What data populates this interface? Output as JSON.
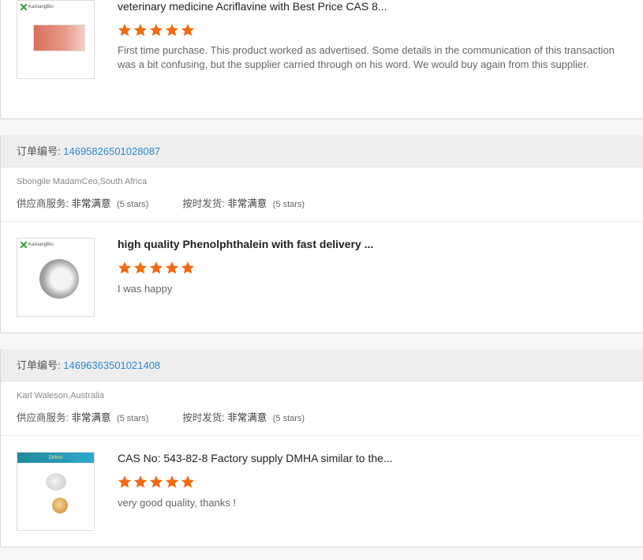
{
  "colors": {
    "accent": "#2b89c6",
    "star": "#f26a10"
  },
  "labels": {
    "order_no": "订单编号:",
    "supplier_service": "供应商服务:",
    "on_time": "按时发货:"
  },
  "card1": {
    "product_title": "veterinary medicine Acriflavine with Best Price CAS 8...",
    "rating": 5,
    "review": "First time purchase.  This product worked as advertised.  Some details in the communication of this transaction was a bit confusing, but the supplier carried through on his word.  We would buy again from this supplier.",
    "brand": "KaixiangBio"
  },
  "orders": [
    {
      "order_id": "14695826501028087",
      "buyer": "Sbongile MadamCeo,South Africa",
      "supplier_value": "非常满意",
      "supplier_stars": "(5 stars)",
      "ontime_value": "非常满意",
      "ontime_stars": "(5 stars)",
      "product_title": "high quality Phenolphthalein with fast delivery ...",
      "rating": 5,
      "review": "I was happy",
      "brand": "KaixiangBio"
    },
    {
      "order_id": "14696363501021408",
      "buyer": "Karl Waleson,Australia",
      "supplier_value": "非常满意",
      "supplier_stars": "(5 stars)",
      "ontime_value": "非常满意",
      "ontime_stars": "(5 stars)",
      "product_title": "CAS No: 543-82-8 Factory supply DMHA similar to the...",
      "rating": 5,
      "review": "very good quality, thanks !",
      "banner": "DMHA"
    }
  ]
}
